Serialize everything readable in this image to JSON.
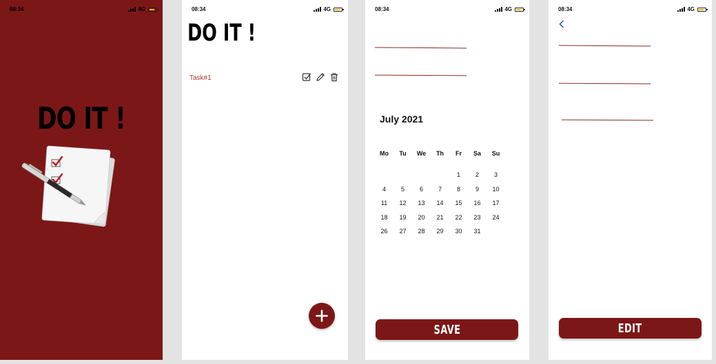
{
  "status_bar": {
    "time": "08:34",
    "network": "4G",
    "battery_color": "#f1c40f"
  },
  "splash": {
    "title": "DO IT !",
    "background_color": "#7c1717",
    "logo_icon": "notepad-checklist-pen-icon"
  },
  "list_screen": {
    "title": "DO IT !",
    "tasks": [
      {
        "label": "Task#1",
        "actions": [
          "check-square-icon",
          "pencil-icon",
          "trash-icon"
        ]
      }
    ],
    "fab_icon": "plus-icon"
  },
  "new_task_screen": {
    "calendar": {
      "month_label": "July 2021",
      "weekdays": [
        "Mo",
        "Tu",
        "We",
        "Th",
        "Fr",
        "Sa",
        "Su"
      ],
      "weeks": [
        [
          "",
          "",
          "",
          "",
          "1",
          "2",
          "3"
        ],
        [
          "4",
          "5",
          "6",
          "7",
          "8",
          "9",
          "10"
        ],
        [
          "11",
          "12",
          "13",
          "14",
          "15",
          "16",
          "17"
        ],
        [
          "18",
          "19",
          "20",
          "21",
          "22",
          "23",
          "24"
        ],
        [
          "26",
          "27",
          "28",
          "29",
          "30",
          "31",
          ""
        ]
      ]
    },
    "save_label": "SAVE"
  },
  "edit_screen": {
    "back_icon": "chevron-left-icon",
    "edit_label": "EDIT"
  },
  "colors": {
    "brand": "#7c1717",
    "task_text": "#a33b2c",
    "field_line": "#8a2a22",
    "back_arrow": "#1e5a96"
  }
}
